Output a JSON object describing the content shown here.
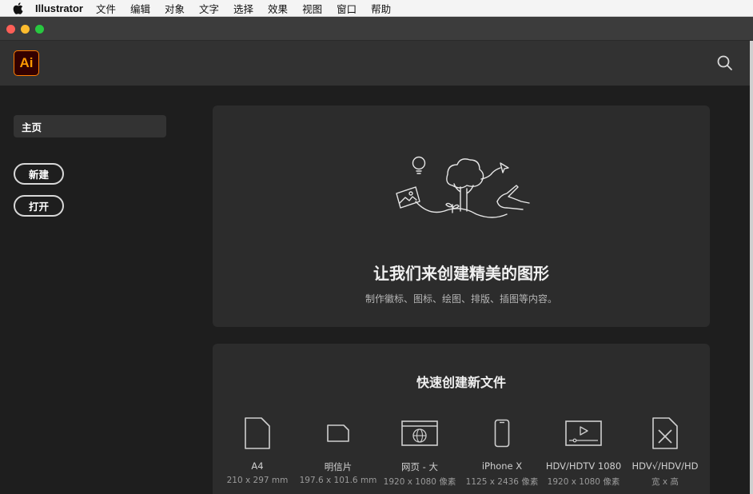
{
  "menubar": {
    "app_name": "Illustrator",
    "items": [
      "文件",
      "编辑",
      "对象",
      "文字",
      "选择",
      "效果",
      "视图",
      "窗口",
      "帮助"
    ]
  },
  "header": {
    "logo_text": "Ai",
    "search_icon": "search-icon"
  },
  "sidebar": {
    "home_label": "主页",
    "new_label": "新建",
    "open_label": "打开"
  },
  "hero": {
    "title": "让我们来创建精美的图形",
    "subtitle": "制作徽标、图标、绘图、排版、插图等内容。"
  },
  "quick_create": {
    "title": "快速创建新文件",
    "presets": [
      {
        "name": "A4",
        "size": "210 x 297 mm",
        "icon": "document-icon"
      },
      {
        "name": "明信片",
        "size": "197.6 x 101.6 mm",
        "icon": "postcard-icon"
      },
      {
        "name": "网页 - 大",
        "size": "1920 x 1080 像素",
        "icon": "web-globe-icon"
      },
      {
        "name": "iPhone X",
        "size": "1125 x 2436 像素",
        "icon": "phone-icon"
      },
      {
        "name": "HDV/HDTV 1080",
        "size": "1920 x 1080 像素",
        "icon": "video-icon"
      },
      {
        "name": "HDV√/HDV/HD",
        "size": "宽 x 高",
        "icon": "tools-document-icon"
      }
    ]
  },
  "colors": {
    "accent_logo": "#ff9a00",
    "logo_bg": "#330000",
    "panel": "#2c2c2c",
    "background": "#1e1e1e"
  }
}
